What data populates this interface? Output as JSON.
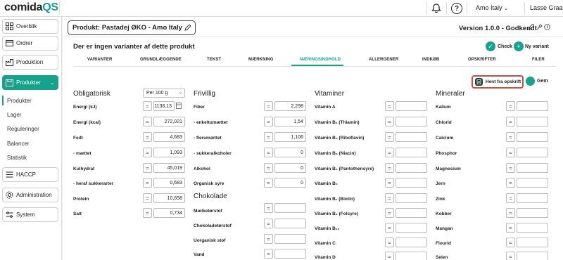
{
  "app": {
    "logo_main": "comida",
    "logo_accent": "QS"
  },
  "topbar": {
    "company": "Amo Italy",
    "company_chevron": "⌄",
    "user": "Lasse Graa",
    "help_label": "?"
  },
  "sidebar": {
    "items": [
      {
        "label": "Overblik",
        "icon": "grid-icon"
      },
      {
        "label": "Ordrer",
        "icon": "orders-icon"
      },
      {
        "label": "Produktion",
        "icon": "production-icon"
      },
      {
        "label": "Produkter",
        "icon": "products-icon",
        "active": true
      },
      {
        "label": "HACCP",
        "icon": "haccp-icon"
      },
      {
        "label": "Administration",
        "icon": "gear-icon"
      },
      {
        "label": "System",
        "icon": "system-icon"
      }
    ],
    "sub_items": [
      "Produkter",
      "Lager",
      "Reguleringer",
      "Balancer",
      "Statistik"
    ],
    "chevron": "⌄"
  },
  "header": {
    "product_title": "Produkt: Pastadej ØKO - Amo Italy",
    "version": "Version 1.0.0 - Godkendt"
  },
  "card": {
    "title": "Der er ingen varianter af dette produkt",
    "check_label": "Check",
    "new_variant_label": "Ny variant",
    "check_symbol": "✓",
    "plus_symbol": "+"
  },
  "tabs": [
    "VARIANTER",
    "GRUNDLÆGGENDE",
    "TEKST",
    "MÆRKNING",
    "NÆRINGSINDHOLD",
    "ALLERGENER",
    "INDKØB",
    "OPSKRIFTER",
    "FILER"
  ],
  "actions": {
    "hent_label": "Hent fra opskrift",
    "gem_label": "Gem"
  },
  "obligatorisk": {
    "title": "Obligatorisk",
    "per_select": "Per 100 g",
    "rows": [
      {
        "label": "Energi (kJ)",
        "value": "1138,13"
      },
      {
        "label": "Energi (kcal)",
        "value": "272,021"
      },
      {
        "label": "Fedt",
        "value": "4,683"
      },
      {
        "label": "- mættet",
        "value": "1,093"
      },
      {
        "label": "Kulhydrat",
        "value": "45,019"
      },
      {
        "label": "- heraf sukkerarter",
        "value": "0,683"
      },
      {
        "label": "Protein",
        "value": "10,658"
      },
      {
        "label": "Salt",
        "value": "0,734"
      }
    ]
  },
  "frivillig": {
    "title": "Frivillig",
    "rows": [
      {
        "label": "Fiber",
        "value": "2,298"
      },
      {
        "label": "- enkeltumættet",
        "value": "1,54"
      },
      {
        "label": "- flerumættet",
        "value": "1,106"
      },
      {
        "label": "- sukkeralkoholer",
        "value": "0"
      },
      {
        "label": "Alkohol",
        "value": "0"
      },
      {
        "label": "Organisk syre",
        "value": "0"
      }
    ]
  },
  "chokolade": {
    "title": "Chokolade",
    "rows": [
      {
        "label": "Mælketørstof",
        "value": ""
      },
      {
        "label": "Chokoladetørstof",
        "value": ""
      },
      {
        "label": "Uorganisk stof",
        "value": ""
      },
      {
        "label": "Vand",
        "value": ""
      }
    ]
  },
  "vitaminer": {
    "title": "Vitaminer",
    "rows": [
      {
        "label": "Vitamin A",
        "value": ""
      },
      {
        "label": "Vitamin B₁ (Thiamin)",
        "value": ""
      },
      {
        "label": "Vitamin B₂ (Riboflavin)",
        "value": ""
      },
      {
        "label": "Vitamin B₃ (Niacin)",
        "value": ""
      },
      {
        "label": "Vitamin B₅ (Pantothensyre)",
        "value": ""
      },
      {
        "label": "Vitamin B₆",
        "value": ""
      },
      {
        "label": "Vitamin B₇ (Biotin)",
        "value": ""
      },
      {
        "label": "Vitamin B₉ (Folsyre)",
        "value": ""
      },
      {
        "label": "Vitamin B₁₂",
        "value": ""
      },
      {
        "label": "Vitamin C",
        "value": ""
      },
      {
        "label": "Vitamin D",
        "value": ""
      }
    ]
  },
  "mineraler": {
    "title": "Mineraler",
    "rows": [
      {
        "label": "Kalium",
        "value": ""
      },
      {
        "label": "Chlorid",
        "value": ""
      },
      {
        "label": "Calcium",
        "value": ""
      },
      {
        "label": "Phosphor",
        "value": ""
      },
      {
        "label": "Magnesium",
        "value": ""
      },
      {
        "label": "Jern",
        "value": ""
      },
      {
        "label": "Zink",
        "value": ""
      },
      {
        "label": "Kobber",
        "value": ""
      },
      {
        "label": "Mangan",
        "value": ""
      },
      {
        "label": "Flourid",
        "value": ""
      },
      {
        "label": "Selen",
        "value": ""
      }
    ]
  },
  "eq_symbol": "=",
  "colors": {
    "accent": "#14a38b",
    "highlight": "#d04a4a"
  }
}
